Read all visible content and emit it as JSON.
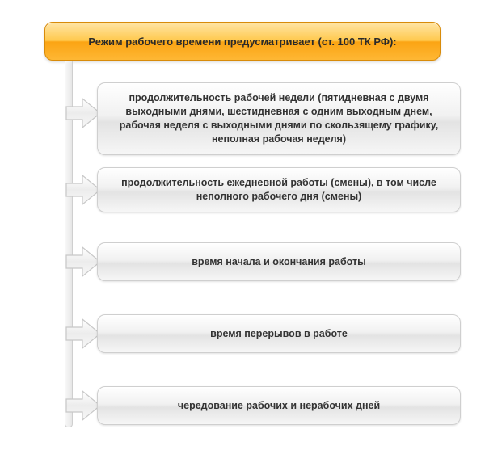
{
  "colors": {
    "header_gradient_top": "#ffe5a6",
    "header_gradient_bottom": "#feb734",
    "header_border": "#d88b0a",
    "item_border": "#cfcfcf"
  },
  "header": {
    "title": "Режим рабочего времени предусматривает (ст. 100 ТК РФ):"
  },
  "items": [
    {
      "text": "продолжительность рабочей недели (пятидневная с двумя выходными днями, шестидневная с одним выходным днем, рабочая неделя с выходными днями по скользящему графику, неполная рабочая неделя)"
    },
    {
      "text": "продолжительность ежедневной работы (смены), в том числе неполного рабочего дня (смены)"
    },
    {
      "text": "время начала и окончания работы"
    },
    {
      "text": "время перерывов в работе"
    },
    {
      "text": "чередование рабочих и нерабочих дней"
    }
  ]
}
